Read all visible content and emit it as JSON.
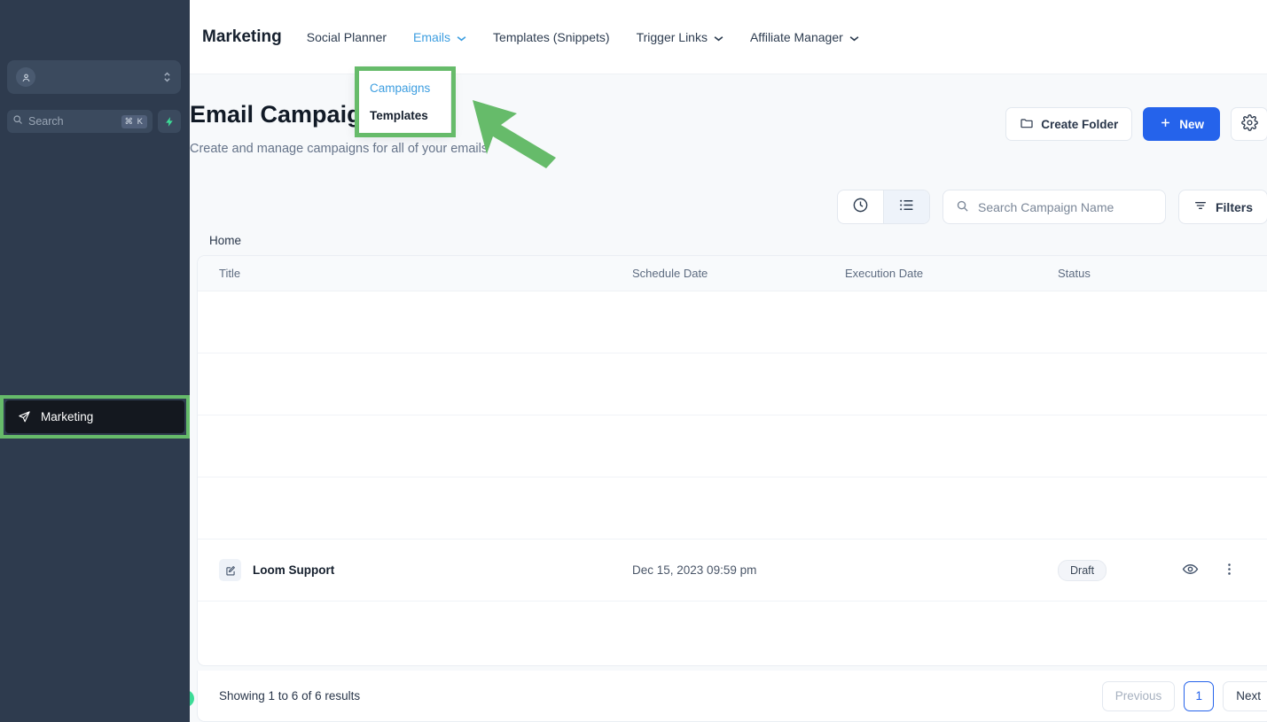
{
  "sidebar": {
    "account": {
      "name": "",
      "avatar_icon": "user-circle-icon",
      "chevron_icon": "chevron-updown-icon"
    },
    "search": {
      "placeholder": "Search",
      "shortcut": "⌘ K",
      "icon": "search-icon",
      "bolt_icon": "bolt-icon"
    },
    "items": [
      {
        "label": "Marketing",
        "icon": "paper-plane-icon",
        "active": true
      }
    ]
  },
  "topnav": {
    "brand": "Marketing",
    "links": [
      {
        "label": "Social Planner",
        "has_chevron": false,
        "active": false
      },
      {
        "label": "Emails",
        "has_chevron": true,
        "active": true
      },
      {
        "label": "Templates (Snippets)",
        "has_chevron": false,
        "active": false
      },
      {
        "label": "Trigger Links",
        "has_chevron": true,
        "active": false
      },
      {
        "label": "Affiliate Manager",
        "has_chevron": true,
        "active": false
      }
    ]
  },
  "dropdown": {
    "items": [
      {
        "label": "Campaigns",
        "selected": true
      },
      {
        "label": "Templates",
        "selected": false
      }
    ]
  },
  "header": {
    "title": "Email Campaigns",
    "subtitle": "Create and manage campaigns for all of your emails",
    "create_folder_label": "Create Folder",
    "create_folder_icon": "folder-icon",
    "new_label": "New",
    "new_icon": "plus-icon",
    "settings_icon": "gear-icon"
  },
  "toolbar": {
    "history_icon": "clock-icon",
    "list_icon": "list-icon",
    "search_placeholder": "Search Campaign Name",
    "search_icon": "search-icon",
    "filters_label": "Filters",
    "filters_icon": "filter-icon"
  },
  "breadcrumb": "Home",
  "table": {
    "columns": [
      "Title",
      "Schedule Date",
      "Execution Date",
      "Status"
    ],
    "rows": [
      {
        "title": "",
        "schedule_date": "",
        "execution_date": "",
        "status": "",
        "blank": true
      },
      {
        "title": "",
        "schedule_date": "",
        "execution_date": "",
        "status": "",
        "blank": true
      },
      {
        "title": "",
        "schedule_date": "",
        "execution_date": "",
        "status": "",
        "blank": true
      },
      {
        "title": "",
        "schedule_date": "",
        "execution_date": "",
        "status": "",
        "blank": true
      },
      {
        "title": "Loom Support",
        "schedule_date": "Dec 15, 2023 09:59 pm",
        "execution_date": "",
        "status": "Draft",
        "blank": false,
        "icon": "edit-square-icon",
        "view_icon": "eye-icon",
        "menu_icon": "dots-vertical-icon"
      }
    ]
  },
  "footer": {
    "showing": "Showing 1 to 6 of 6 results",
    "previous_label": "Previous",
    "page_number": "1",
    "next_label": "Next"
  },
  "annotations": {
    "highlight_color": "#66bb6a",
    "arrow_color": "#66bb6a"
  },
  "colors": {
    "sidebar_bg": "#2e3b4e",
    "primary_blue": "#2563eb",
    "link_blue": "#3d9ee0",
    "green_accent": "#3ddc97"
  }
}
